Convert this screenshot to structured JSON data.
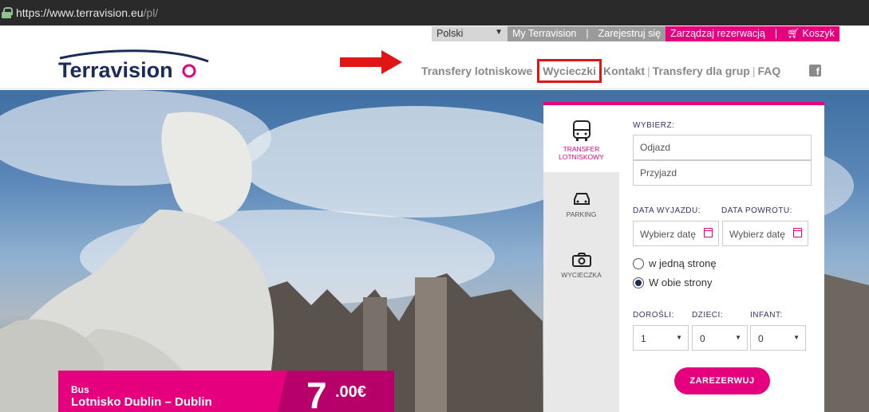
{
  "browser": {
    "url_host": "https://www.terravision.eu",
    "url_path": "/pl/"
  },
  "topbar": {
    "language": "Polski",
    "my_account": "My Terravision",
    "register": "Zarejestruj się",
    "manage_booking": "Zarządzaj rezerwacją",
    "cart": "Koszyk"
  },
  "logo_text": "Terravision",
  "nav": {
    "airport_transfers": "Transfery lotniskowe",
    "tours": "Wycieczki",
    "contact": "Kontakt",
    "group_transfers": "Transfery dla grup",
    "faq": "FAQ"
  },
  "widget": {
    "tabs": {
      "transfer_line1": "TRANSFER",
      "transfer_line2": "LOTNISKOWY",
      "parking": "PARKING",
      "tour": "WYCIECZKA"
    },
    "choose_label": "WYBIERZ:",
    "departure_placeholder": "Odjazd",
    "arrival_placeholder": "Przyjazd",
    "departure_date_label": "DATA WYJAZDU:",
    "return_date_label": "DATA POWROTU:",
    "date_placeholder": "Wybierz datę",
    "one_way": "w jedną stronę",
    "round_trip": "W obie strony",
    "adults_label": "DOROŚLI:",
    "children_label": "DZIECI:",
    "infant_label": "INFANT:",
    "adults_value": "1",
    "children_value": "0",
    "infant_value": "0",
    "book_button": "ZAREZERWUJ"
  },
  "promo": {
    "type": "Bus",
    "route": "Lotnisko Dublin – Dublin",
    "price_int": "7",
    "price_dec": ".00€"
  },
  "colors": {
    "accent": "#e5007e",
    "navy": "#1b2b5a",
    "highlight_red": "#e01515"
  }
}
